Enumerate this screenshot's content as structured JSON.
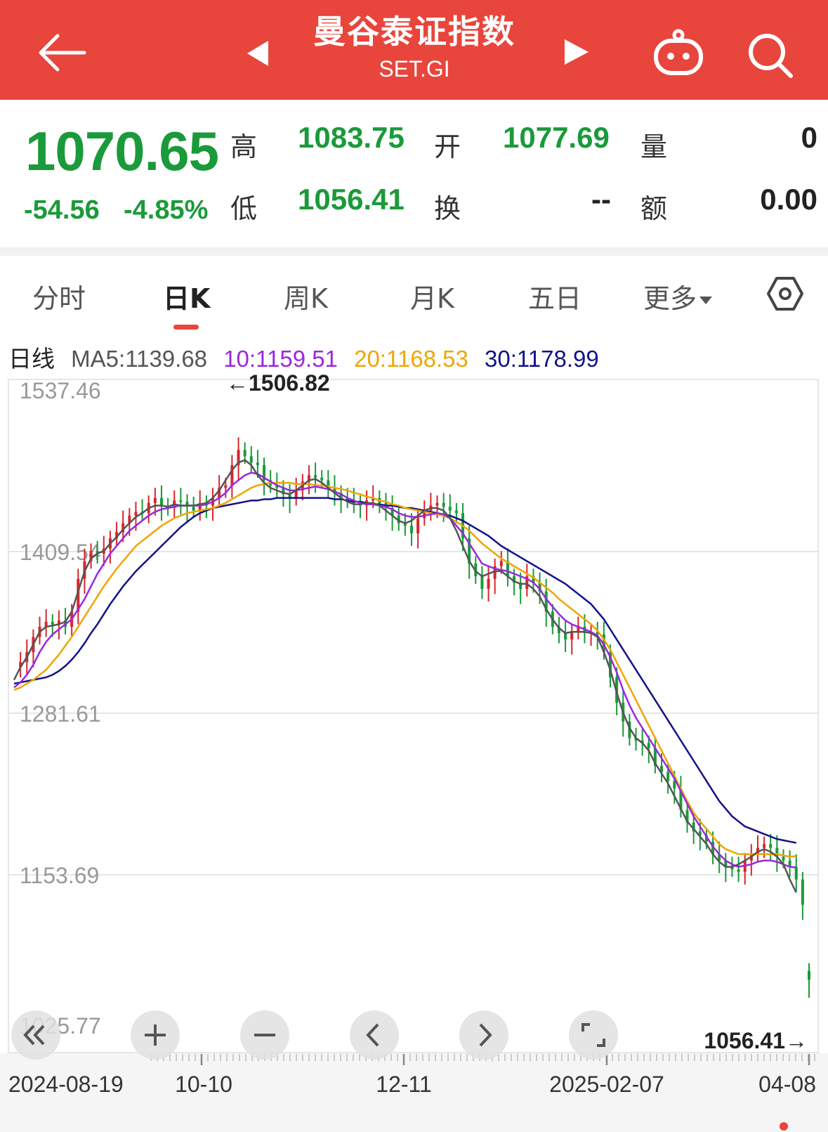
{
  "header": {
    "title": "曼谷泰证指数",
    "subtitle": "SET.GI",
    "icons": [
      "back-arrow-icon",
      "prev-triangle-icon",
      "next-triangle-icon",
      "robot-icon",
      "search-icon"
    ]
  },
  "quote": {
    "price": "1070.65",
    "change": "-54.56",
    "change_pct": "-4.85%",
    "high_label": "高",
    "high": "1083.75",
    "open_label": "开",
    "open": "1077.69",
    "volume_label": "量",
    "volume": "0",
    "low_label": "低",
    "low": "1056.41",
    "turnover_label": "换",
    "turnover": "--",
    "amount_label": "额",
    "amount": "0.00"
  },
  "tabs": [
    {
      "label": "分时"
    },
    {
      "label": "日K",
      "active": true
    },
    {
      "label": "周K"
    },
    {
      "label": "月K"
    },
    {
      "label": "五日"
    },
    {
      "label": "更多"
    }
  ],
  "ma": {
    "label": "日线",
    "ma5": "MA5:1139.68",
    "ma10": "10:1159.51",
    "ma20": "20:1168.53",
    "ma30": "30:1178.99"
  },
  "colors": {
    "brand": "#e8453c",
    "down": "#1a9a3a",
    "up": "#d7262c",
    "ma5": "#555555",
    "ma10": "#9b27e0",
    "ma20": "#f0a500",
    "ma30": "#12128a"
  },
  "chart_data": {
    "type": "candlestick",
    "y_ticks": [
      "1537.46",
      "1409.54",
      "1281.61",
      "1153.69",
      "1025.77"
    ],
    "ylim": [
      1025.77,
      1537.46
    ],
    "x_ticks": [
      "2024-08-19",
      "10-10",
      "12-11",
      "2025-02-07",
      "04-08"
    ],
    "max_annotation": "←1506.82",
    "min_annotation": "1056.41→",
    "max_value": 1506.82,
    "min_value": 1056.41,
    "last": {
      "open": 1077.69,
      "high": 1083.75,
      "low": 1056.41,
      "close": 1070.65
    },
    "close_series": [
      1318,
      1322,
      1330,
      1342,
      1350,
      1354,
      1352,
      1355,
      1350,
      1362,
      1388,
      1402,
      1410,
      1408,
      1412,
      1420,
      1425,
      1432,
      1438,
      1441,
      1440,
      1448,
      1452,
      1446,
      1444,
      1450,
      1449,
      1445,
      1442,
      1448,
      1446,
      1452,
      1460,
      1462,
      1478,
      1490,
      1485,
      1480,
      1478,
      1466,
      1462,
      1460,
      1455,
      1452,
      1458,
      1465,
      1470,
      1468,
      1466,
      1460,
      1456,
      1452,
      1450,
      1448,
      1446,
      1450,
      1452,
      1448,
      1444,
      1438,
      1432,
      1430,
      1424,
      1436,
      1442,
      1446,
      1448,
      1445,
      1442,
      1440,
      1420,
      1400,
      1390,
      1380,
      1388,
      1398,
      1402,
      1390,
      1385,
      1380,
      1390,
      1385,
      1378,
      1362,
      1350,
      1345,
      1340,
      1346,
      1350,
      1345,
      1346,
      1344,
      1330,
      1310,
      1290,
      1275,
      1262,
      1260,
      1258,
      1254,
      1240,
      1235,
      1228,
      1222,
      1205,
      1195,
      1188,
      1185,
      1180,
      1170,
      1165,
      1160,
      1158,
      1156,
      1165,
      1170,
      1175,
      1178,
      1175,
      1168,
      1165,
      1160,
      1150,
      1130,
      1070.65
    ],
    "ma5_series": [
      1308,
      1318,
      1326,
      1336,
      1346,
      1350,
      1351,
      1352,
      1354,
      1362,
      1378,
      1394,
      1404,
      1408,
      1410,
      1416,
      1421,
      1427,
      1432,
      1437,
      1440,
      1444,
      1446,
      1446,
      1445,
      1447,
      1446,
      1446,
      1446,
      1447,
      1448,
      1452,
      1458,
      1466,
      1474,
      1480,
      1482,
      1478,
      1470,
      1464,
      1460,
      1458,
      1456,
      1455,
      1458,
      1462,
      1466,
      1467,
      1464,
      1460,
      1456,
      1452,
      1449,
      1447,
      1447,
      1448,
      1448,
      1446,
      1442,
      1438,
      1434,
      1432,
      1434,
      1438,
      1442,
      1444,
      1444,
      1442,
      1436,
      1426,
      1414,
      1402,
      1394,
      1390,
      1392,
      1394,
      1394,
      1390,
      1386,
      1384,
      1384,
      1380,
      1374,
      1364,
      1356,
      1349,
      1345,
      1346,
      1346,
      1346,
      1345,
      1342,
      1330,
      1316,
      1298,
      1282,
      1270,
      1262,
      1258,
      1252,
      1242,
      1234,
      1226,
      1216,
      1206,
      1196,
      1190,
      1184,
      1178,
      1170,
      1164,
      1160,
      1160,
      1162,
      1165,
      1168,
      1172,
      1174,
      1172,
      1168,
      1162,
      1150,
      1139.68
    ],
    "ma10_series": [
      1302,
      1306,
      1312,
      1320,
      1330,
      1338,
      1344,
      1348,
      1352,
      1356,
      1364,
      1372,
      1382,
      1392,
      1400,
      1408,
      1414,
      1420,
      1426,
      1430,
      1434,
      1438,
      1441,
      1443,
      1444,
      1445,
      1446,
      1446,
      1446,
      1446,
      1447,
      1449,
      1452,
      1456,
      1462,
      1466,
      1470,
      1472,
      1471,
      1468,
      1465,
      1462,
      1460,
      1458,
      1458,
      1459,
      1460,
      1461,
      1460,
      1459,
      1457,
      1455,
      1452,
      1450,
      1448,
      1447,
      1447,
      1446,
      1445,
      1443,
      1440,
      1438,
      1437,
      1437,
      1438,
      1439,
      1440,
      1439,
      1436,
      1430,
      1424,
      1416,
      1408,
      1400,
      1398,
      1396,
      1395,
      1394,
      1392,
      1390,
      1388,
      1385,
      1380,
      1372,
      1366,
      1360,
      1355,
      1352,
      1350,
      1348,
      1346,
      1343,
      1336,
      1326,
      1314,
      1300,
      1288,
      1278,
      1270,
      1262,
      1254,
      1246,
      1238,
      1230,
      1220,
      1210,
      1200,
      1192,
      1184,
      1176,
      1170,
      1165,
      1162,
      1160,
      1161,
      1162,
      1164,
      1165,
      1165,
      1164,
      1162,
      1160,
      1159.51
    ],
    "ma20_series": [
      1300,
      1302,
      1305,
      1308,
      1312,
      1316,
      1322,
      1328,
      1335,
      1342,
      1350,
      1358,
      1366,
      1374,
      1382,
      1389,
      1396,
      1402,
      1408,
      1414,
      1418,
      1422,
      1426,
      1430,
      1433,
      1436,
      1438,
      1440,
      1441,
      1442,
      1443,
      1444,
      1446,
      1448,
      1451,
      1454,
      1457,
      1460,
      1462,
      1463,
      1464,
      1464,
      1464,
      1464,
      1463,
      1463,
      1463,
      1462,
      1462,
      1461,
      1460,
      1459,
      1458,
      1456,
      1455,
      1453,
      1452,
      1450,
      1449,
      1447,
      1446,
      1444,
      1443,
      1442,
      1441,
      1440,
      1439,
      1438,
      1436,
      1433,
      1430,
      1426,
      1421,
      1416,
      1412,
      1408,
      1404,
      1401,
      1398,
      1395,
      1392,
      1389,
      1385,
      1381,
      1377,
      1372,
      1368,
      1364,
      1360,
      1356,
      1352,
      1347,
      1340,
      1332,
      1322,
      1312,
      1302,
      1292,
      1282,
      1272,
      1262,
      1252,
      1242,
      1232,
      1222,
      1212,
      1203,
      1196,
      1190,
      1184,
      1178,
      1174,
      1172,
      1170,
      1170,
      1170,
      1170,
      1170,
      1170,
      1170,
      1169,
      1168,
      1168.53
    ],
    "ma30_series": [
      1305,
      1306,
      1307,
      1308,
      1309,
      1310,
      1312,
      1315,
      1319,
      1324,
      1330,
      1337,
      1345,
      1352,
      1360,
      1368,
      1375,
      1382,
      1388,
      1394,
      1399,
      1404,
      1409,
      1414,
      1419,
      1424,
      1429,
      1433,
      1437,
      1440,
      1442,
      1444,
      1445,
      1446,
      1447,
      1448,
      1449,
      1450,
      1450,
      1451,
      1451,
      1452,
      1452,
      1452,
      1452,
      1452,
      1452,
      1452,
      1452,
      1452,
      1451,
      1451,
      1450,
      1449,
      1449,
      1448,
      1447,
      1447,
      1446,
      1446,
      1445,
      1444,
      1444,
      1443,
      1442,
      1441,
      1440,
      1439,
      1438,
      1436,
      1434,
      1431,
      1428,
      1425,
      1422,
      1418,
      1414,
      1411,
      1408,
      1405,
      1402,
      1399,
      1396,
      1393,
      1390,
      1387,
      1384,
      1380,
      1376,
      1372,
      1368,
      1362,
      1356,
      1348,
      1340,
      1332,
      1324,
      1316,
      1308,
      1300,
      1292,
      1284,
      1276,
      1268,
      1260,
      1252,
      1244,
      1236,
      1228,
      1220,
      1212,
      1206,
      1200,
      1196,
      1192,
      1190,
      1188,
      1186,
      1184,
      1182,
      1181,
      1180,
      1178.99
    ]
  }
}
